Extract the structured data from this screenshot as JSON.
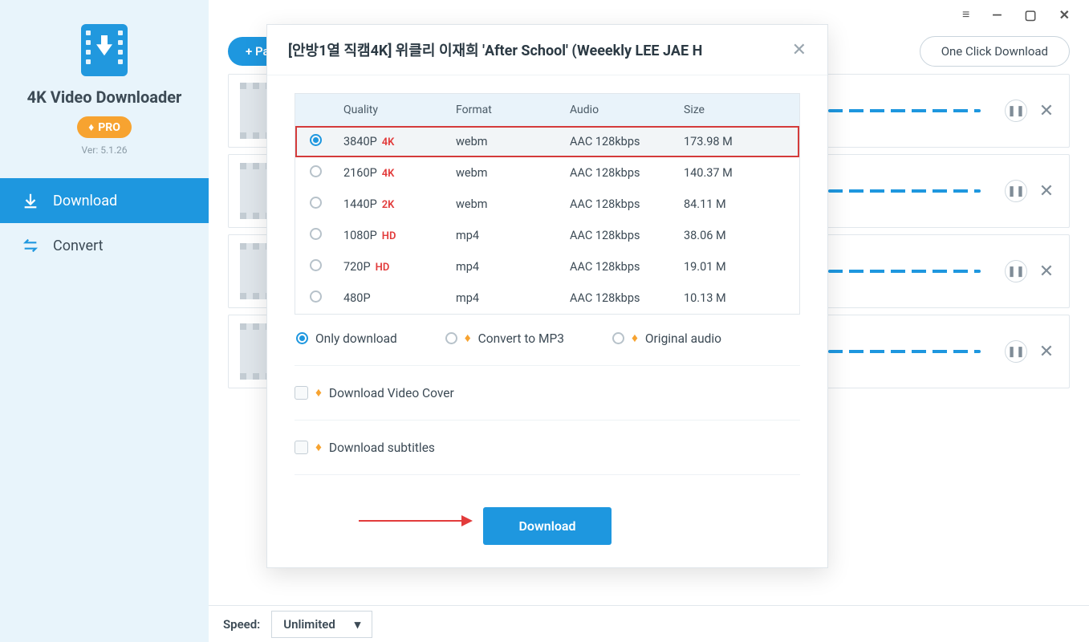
{
  "brand": {
    "name": "4K Video Downloader",
    "pro_label": "PRO",
    "version": "Ver: 5.1.26"
  },
  "nav": {
    "download": "Download",
    "convert": "Convert"
  },
  "toolbar": {
    "paste_label": "+ Pa",
    "one_click_label": "One Click Download"
  },
  "statusbar": {
    "speed_label": "Speed:",
    "speed_value": "Unlimited"
  },
  "dialog": {
    "title": "[안방1열 직캠4K] 위클리 이재희 'After School' (Weeekly LEE JAE H",
    "columns": {
      "quality": "Quality",
      "format": "Format",
      "audio": "Audio",
      "size": "Size"
    },
    "rows": [
      {
        "quality": "3840P",
        "tag": "4K",
        "format": "webm",
        "audio": "AAC 128kbps",
        "size": "173.98 M",
        "selected": true
      },
      {
        "quality": "2160P",
        "tag": "4K",
        "format": "webm",
        "audio": "AAC 128kbps",
        "size": "140.37 M",
        "selected": false
      },
      {
        "quality": "1440P",
        "tag": "2K",
        "format": "webm",
        "audio": "AAC 128kbps",
        "size": "84.11 M",
        "selected": false
      },
      {
        "quality": "1080P",
        "tag": "HD",
        "format": "mp4",
        "audio": "AAC 128kbps",
        "size": "38.06 M",
        "selected": false
      },
      {
        "quality": "720P",
        "tag": "HD",
        "format": "mp4",
        "audio": "AAC 128kbps",
        "size": "19.01 M",
        "selected": false
      },
      {
        "quality": "480P",
        "tag": "",
        "format": "mp4",
        "audio": "AAC 128kbps",
        "size": "10.13 M",
        "selected": false
      }
    ],
    "options": {
      "only_download": "Only download",
      "convert_mp3": "Convert to MP3",
      "original_audio": "Original audio",
      "download_cover": "Download Video Cover",
      "download_subs": "Download subtitles"
    },
    "download_btn": "Download"
  }
}
